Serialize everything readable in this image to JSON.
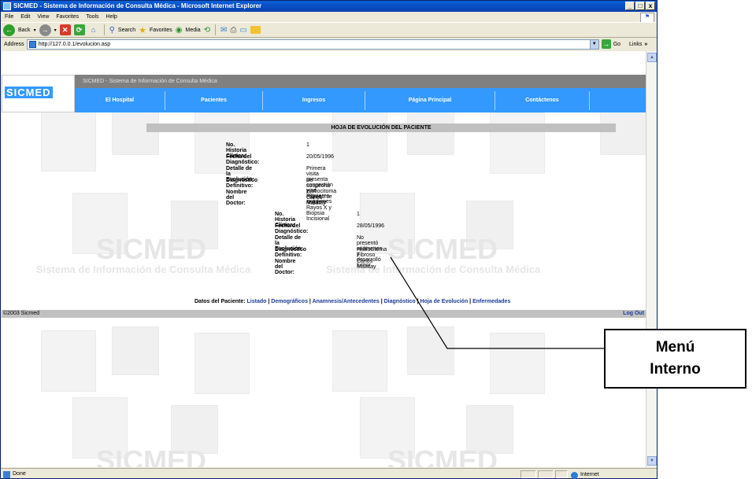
{
  "window": {
    "title": "SICMED - Sistema de Información de Consulta Médica - Microsoft Internet Explorer",
    "controls": [
      "_",
      "□",
      "x"
    ]
  },
  "menubar": [
    "File",
    "Edit",
    "View",
    "Favorites",
    "Tools",
    "Help"
  ],
  "toolbar": {
    "back": "Back",
    "search": "Search",
    "favorites": "Favorites",
    "media": "Media"
  },
  "address": {
    "label": "Address",
    "url": "http://127.0.0.1/evolucion.asp",
    "go": "Go",
    "links": "Links"
  },
  "site": {
    "logo": "SICMED",
    "title": "SICMED - Sistema de Información de Consulta Médica",
    "nav": [
      "El Hospital",
      "Pacientes",
      "Ingresos",
      "Página Principal",
      "Contáctenos"
    ],
    "watermark_big": "SICMED",
    "watermark_small": "Sistema de Información de Consulta Médica"
  },
  "sheet": {
    "heading": "HOJA DE EVOLUCIÓN DEL PACIENTE",
    "labels": {
      "historia": "No. Historia Clínica:",
      "fecha": "Fecha del Diagnóstico:",
      "detalle": "Detalle de la Evolución:",
      "diagnostico": "Diagnóstico Definitivo:",
      "doctor": "Nombre del Doctor:"
    },
    "entries": [
      {
        "historia": "1",
        "fecha": "20/05/1996",
        "detalle": "Primera visita presenta congestión y se requieren exámenes",
        "diagnostico": "Se sospecha Histiocitoma Fibroso se requiere Rayos X y Biopsia Incisional",
        "doctor": "Dr. Carlos Malatay"
      },
      {
        "historia": "1",
        "fecha": "28/05/1996",
        "detalle": "No presentó exámenes y desarrolló tumor",
        "diagnostico": "Histiocitoma Fibroso",
        "doctor": "Carlos Malatay"
      }
    ]
  },
  "patient_menu": {
    "label": "Datos del Paciente:",
    "links": [
      "Listado",
      "Demográficos",
      "Anamnesis/Antecedentes",
      "Diagnóstico",
      "Hoja de Evolución",
      "Enfermedades"
    ]
  },
  "footer": {
    "copyright": "©2003 Sicmed",
    "logout": "Log Out"
  },
  "status": {
    "text": "Done",
    "zone": "Internet"
  },
  "annotation": {
    "line1": "Menú",
    "line2": "Interno"
  },
  "colors": {
    "nav_blue": "#3399ff",
    "gray_band": "#c0c0c0",
    "link_blue": "#1a3a9a"
  }
}
